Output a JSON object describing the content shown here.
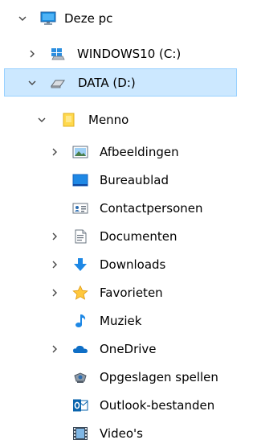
{
  "tree": {
    "root_label": "Deze pc",
    "drive_c_label": "WINDOWS10 (C:)",
    "drive_d_label": "DATA (D:)",
    "user_folder_label": "Menno",
    "items": [
      {
        "label": "Afbeeldingen",
        "icon": "pictures-icon",
        "expandable": true
      },
      {
        "label": "Bureaublad",
        "icon": "desktop-icon",
        "expandable": false
      },
      {
        "label": "Contactpersonen",
        "icon": "contacts-icon",
        "expandable": false
      },
      {
        "label": "Documenten",
        "icon": "documents-icon",
        "expandable": true
      },
      {
        "label": "Downloads",
        "icon": "downloads-icon",
        "expandable": true
      },
      {
        "label": "Favorieten",
        "icon": "favorites-star-icon",
        "expandable": true
      },
      {
        "label": "Muziek",
        "icon": "music-icon",
        "expandable": false
      },
      {
        "label": "OneDrive",
        "icon": "onedrive-cloud-icon",
        "expandable": true
      },
      {
        "label": "Opgeslagen spellen",
        "icon": "saved-games-icon",
        "expandable": false
      },
      {
        "label": "Outlook-bestanden",
        "icon": "outlook-icon",
        "expandable": false
      },
      {
        "label": "Video's",
        "icon": "videos-icon",
        "expandable": false
      }
    ]
  },
  "colors": {
    "selection_bg": "#cce8ff",
    "selection_border": "#99d1ff",
    "chevron": "#444444",
    "folder_yellow": "#ffd94d",
    "accent_blue": "#1e88e5"
  }
}
